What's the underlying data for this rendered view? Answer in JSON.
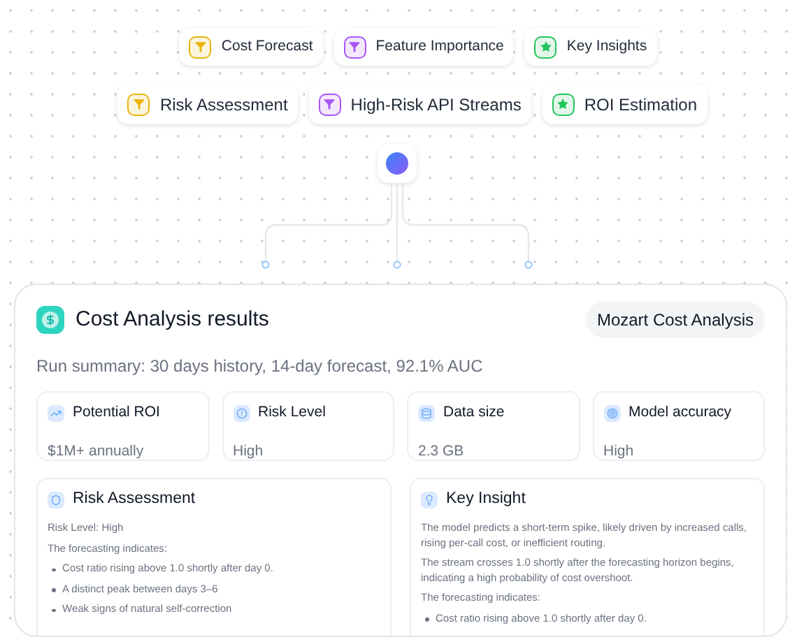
{
  "pill_rows": [
    [
      {
        "label": "Cost Forecast",
        "kind": "filter",
        "color": "#eab308"
      },
      {
        "label": "Feature Importance",
        "kind": "filter",
        "color": "#a855f7"
      },
      {
        "label": "Key Insights",
        "kind": "star",
        "color": "#22c55e"
      }
    ],
    [
      {
        "label": "Risk Assessment",
        "kind": "filter",
        "color": "#eab308"
      },
      {
        "label": "High-Risk API Streams",
        "kind": "filter",
        "color": "#a855f7"
      },
      {
        "label": "ROI Estimation",
        "kind": "star",
        "color": "#22c55e"
      }
    ]
  ],
  "card": {
    "title": "Cost Analysis results",
    "badge": "Mozart Cost Analysis",
    "summary": "Run summary: 30 days history, 14-day forecast, 92.1% AUC",
    "stats": [
      {
        "label": "Potential ROI",
        "value": "$1M+ annually",
        "kind": "chart"
      },
      {
        "label": "Risk Level",
        "value": "High",
        "kind": "alert"
      },
      {
        "label": "Data size",
        "value": "2.3 GB",
        "kind": "database"
      },
      {
        "label": "Model accuracy",
        "value": "High",
        "kind": "target"
      }
    ],
    "panels": [
      {
        "title": "Risk Assessment",
        "kind": "shield",
        "blocks": [
          {
            "kind": "para",
            "text": "Risk Level: High"
          },
          {
            "kind": "para",
            "text": "The forecasting indicates:"
          },
          {
            "kind": "bullet",
            "text": "Cost ratio rising above 1.0 shortly after day 0."
          },
          {
            "kind": "bullet",
            "text": "A distinct peak between days 3–6"
          },
          {
            "kind": "bullet",
            "text": "Weak signs of natural self-correction"
          }
        ]
      },
      {
        "title": "Key Insight",
        "kind": "bulb",
        "blocks": [
          {
            "kind": "para",
            "text": "The model predicts a short-term spike, likely driven by increased calls, rising per-call cost, or inefficient routing."
          },
          {
            "kind": "para",
            "text": "The stream crosses 1.0 shortly after the forecasting horizon begins, indicating a high probability of cost overshoot."
          },
          {
            "kind": "para",
            "text": "The forecasting indicates:"
          },
          {
            "kind": "bullet",
            "text": "Cost ratio rising above 1.0 shortly after day 0."
          }
        ]
      }
    ]
  }
}
